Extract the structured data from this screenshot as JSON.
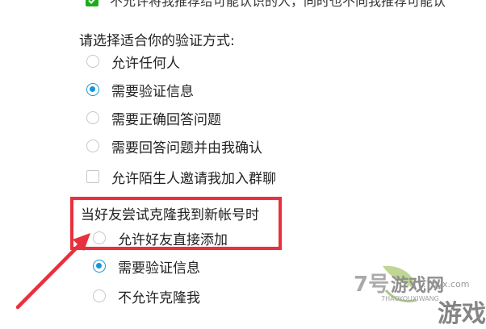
{
  "top": {
    "text": "不允许将我推荐给可能认识的人，同时也不向我推荐可能认"
  },
  "verification": {
    "title": "请选择适合你的验证方式:",
    "options": [
      {
        "label": "允许任何人",
        "checked": false
      },
      {
        "label": "需要验证信息",
        "checked": true
      },
      {
        "label": "需要正确回答问题",
        "checked": false
      },
      {
        "label": "需要回答问题并由我确认",
        "checked": false
      }
    ],
    "group_checkbox_label": "允许陌生人邀请我加入群聊"
  },
  "clone": {
    "title": "当好友尝试克隆我到新帐号时",
    "options": [
      {
        "label": "允许好友直接添加",
        "checked": false
      },
      {
        "label": "需要验证信息",
        "checked": true
      },
      {
        "label": "不允许克隆我",
        "checked": false
      }
    ]
  },
  "colors": {
    "accent": "#1296db",
    "highlight": "#e8313c",
    "check_green": "#1aad19"
  },
  "watermark": {
    "logo_text": "7号",
    "brand": "游戏网",
    "pinyin": "7HAOYOUXIWANG",
    "domain": ".7hyx.com",
    "site": "游戏"
  }
}
